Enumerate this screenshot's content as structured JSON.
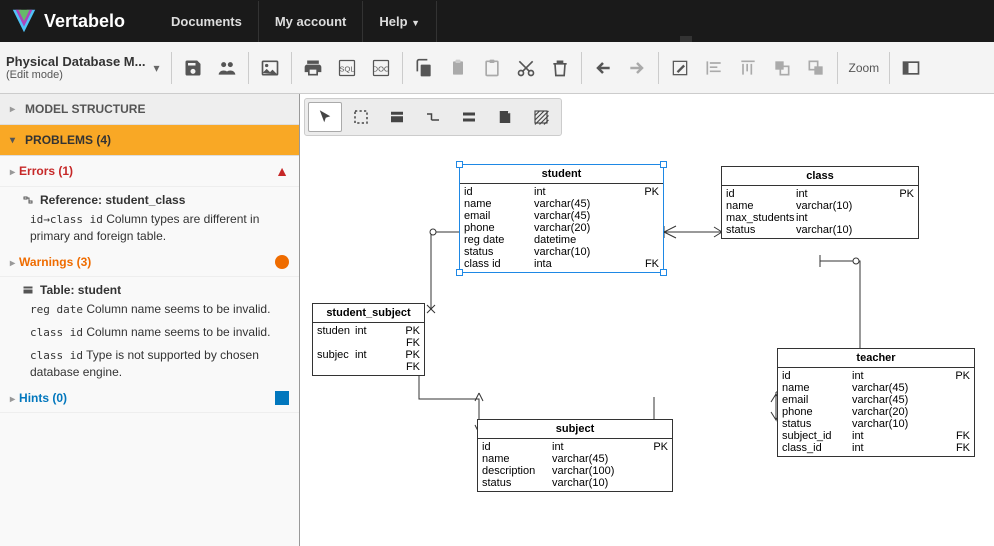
{
  "brand": "Vertabelo",
  "nav": {
    "documents": "Documents",
    "account": "My account",
    "help": "Help"
  },
  "doc": {
    "title": "Physical Database M...",
    "mode": "(Edit mode)"
  },
  "toolbar": {
    "zoom": "Zoom",
    "sql": "SQL",
    "doc": "DOC"
  },
  "sidebar": {
    "model_structure": "MODEL STRUCTURE",
    "problems": "PROBLEMS (4)",
    "errors": {
      "label": "Errors (1)",
      "ref_title": "Reference: student_class",
      "ref_item": {
        "code": "id→class id",
        "text": " Column types are different in primary and foreign table."
      }
    },
    "warnings": {
      "label": "Warnings (3)",
      "tbl_title": "Table: student",
      "w1": {
        "code": "reg date",
        "text": " Column name seems to be invalid."
      },
      "w2": {
        "code": "class id",
        "text": " Column name seems to be invalid."
      },
      "w3": {
        "code": "class id",
        "text": " Type is not supported by chosen database engine."
      }
    },
    "hints": {
      "label": "Hints (0)"
    }
  },
  "entities": {
    "student": {
      "title": "student",
      "cols": [
        {
          "n": "id",
          "t": "int",
          "k": "PK"
        },
        {
          "n": "name",
          "t": "varchar(45)",
          "k": ""
        },
        {
          "n": "email",
          "t": "varchar(45)",
          "k": ""
        },
        {
          "n": "phone",
          "t": "varchar(20)",
          "k": ""
        },
        {
          "n": "reg date",
          "t": "datetime",
          "k": ""
        },
        {
          "n": "status",
          "t": "varchar(10)",
          "k": ""
        },
        {
          "n": "class id",
          "t": "inta",
          "k": "FK"
        }
      ]
    },
    "class": {
      "title": "class",
      "cols": [
        {
          "n": "id",
          "t": "int",
          "k": "PK"
        },
        {
          "n": "name",
          "t": "varchar(10)",
          "k": ""
        },
        {
          "n": "max_students",
          "t": "int",
          "k": ""
        },
        {
          "n": "status",
          "t": "varchar(10)",
          "k": ""
        }
      ]
    },
    "student_subject": {
      "title": "student_subject",
      "cols": [
        {
          "n": "studen",
          "t": "int",
          "k": "PK FK"
        },
        {
          "n": "subjec",
          "t": "int",
          "k": "PK FK"
        }
      ]
    },
    "subject": {
      "title": "subject",
      "cols": [
        {
          "n": "id",
          "t": "int",
          "k": "PK"
        },
        {
          "n": "name",
          "t": "varchar(45)",
          "k": ""
        },
        {
          "n": "description",
          "t": "varchar(100)",
          "k": ""
        },
        {
          "n": "status",
          "t": "varchar(10)",
          "k": ""
        }
      ]
    },
    "teacher": {
      "title": "teacher",
      "cols": [
        {
          "n": "id",
          "t": "int",
          "k": "PK"
        },
        {
          "n": "name",
          "t": "varchar(45)",
          "k": ""
        },
        {
          "n": "email",
          "t": "varchar(45)",
          "k": ""
        },
        {
          "n": "phone",
          "t": "varchar(20)",
          "k": ""
        },
        {
          "n": "status",
          "t": "varchar(10)",
          "k": ""
        },
        {
          "n": "subject_id",
          "t": "int",
          "k": "FK"
        },
        {
          "n": "class_id",
          "t": "int",
          "k": "FK"
        }
      ]
    }
  }
}
